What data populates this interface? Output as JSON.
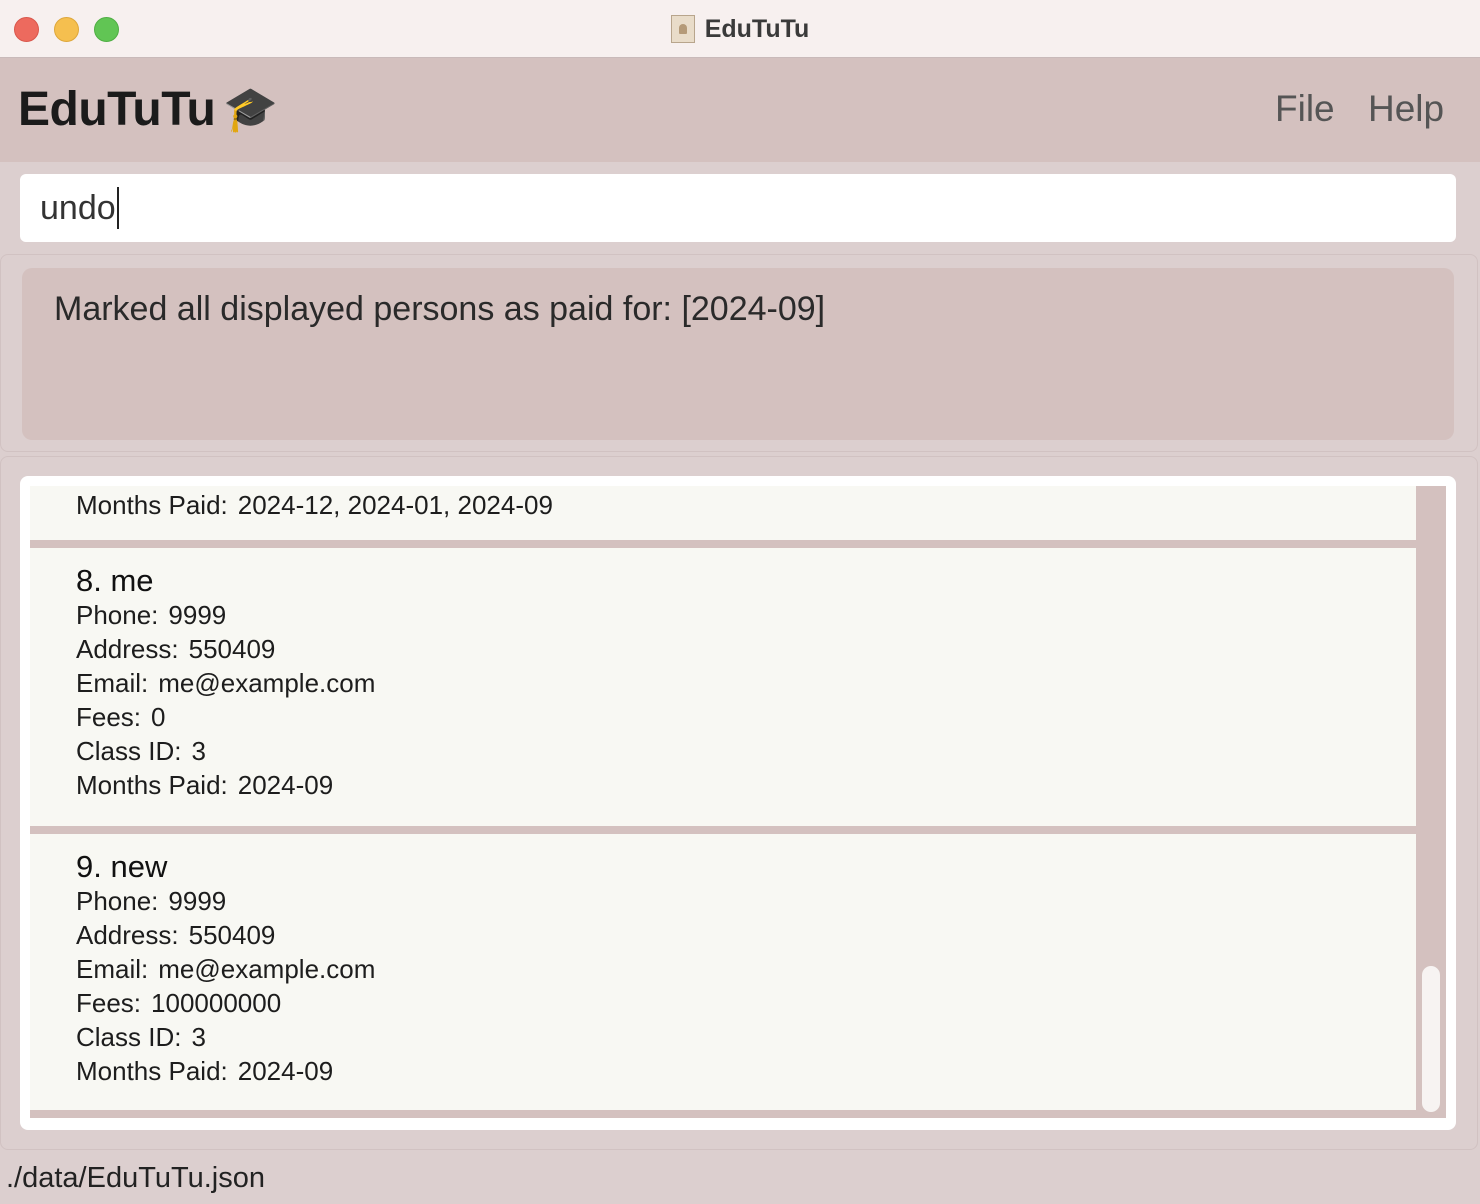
{
  "window": {
    "title": "EduTuTu"
  },
  "menubar": {
    "brand": "EduTuTu",
    "brand_icon": "graduation-cap-icon",
    "menus": [
      "File",
      "Help"
    ]
  },
  "command": {
    "value": "undo"
  },
  "result": {
    "message": "Marked all displayed persons as paid for: [2024-09]"
  },
  "labels": {
    "phone": "Phone:",
    "address": "Address:",
    "email": "Email:",
    "fees": "Fees:",
    "class_id": "Class ID:",
    "months_paid": "Months Paid:"
  },
  "persons": [
    {
      "months_paid": "2024-12, 2024-01, 2024-09"
    },
    {
      "title": "8. me",
      "phone": "9999",
      "address": "550409",
      "email": "me@example.com",
      "fees": "0",
      "class_id": "3",
      "months_paid": "2024-09"
    },
    {
      "title": "9. new",
      "phone": "9999",
      "address": "550409",
      "email": "me@example.com",
      "fees": "100000000",
      "class_id": "3",
      "months_paid": "2024-09"
    }
  ],
  "status": {
    "file_path": "./data/EduTuTu.json"
  }
}
